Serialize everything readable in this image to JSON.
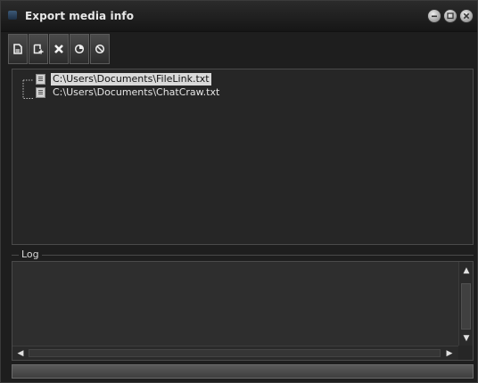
{
  "window": {
    "title": "Export media info",
    "icon": "app-icon",
    "controls": [
      "minimize-icon",
      "maximize-icon",
      "close-icon"
    ]
  },
  "toolbar": {
    "buttons": [
      {
        "name": "new-document-button",
        "icon": "new-document-icon"
      },
      {
        "name": "add-file-button",
        "icon": "add-file-icon"
      },
      {
        "name": "remove-button",
        "icon": "x-icon"
      },
      {
        "name": "export-button",
        "icon": "pie-icon"
      },
      {
        "name": "cancel-button",
        "icon": "no-entry-icon"
      }
    ]
  },
  "files": [
    {
      "path": "C:\\Users\\Documents\\FileLink.txt",
      "selected": true
    },
    {
      "path": "C:\\Users\\Documents\\ChatCraw.txt",
      "selected": false
    }
  ],
  "log": {
    "label": "Log"
  },
  "colors": {
    "window_bg": "#1e1e1e",
    "panel_bg": "#262626",
    "selection_bg": "#d9d9d9",
    "text": "#e6e6e6"
  }
}
